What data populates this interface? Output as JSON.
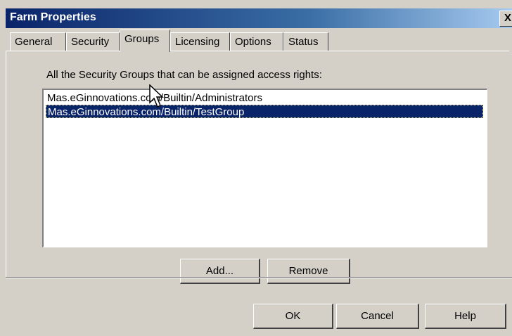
{
  "window": {
    "title": "Farm Properties",
    "close_label": "X"
  },
  "tabs": [
    {
      "label": "General"
    },
    {
      "label": "Security"
    },
    {
      "label": "Groups"
    },
    {
      "label": "Licensing"
    },
    {
      "label": "Options"
    },
    {
      "label": "Status"
    }
  ],
  "active_tab": "Groups",
  "groups_panel": {
    "description": "All the Security Groups that can be assigned access rights:",
    "items": [
      {
        "label": "Mas.eGinnovations.com/Builtin/Administrators",
        "selected": false
      },
      {
        "label": "Mas.eGinnovations.com/Builtin/TestGroup",
        "selected": true
      }
    ],
    "add_label": "Add...",
    "remove_label": "Remove"
  },
  "footer": {
    "ok_label": "OK",
    "cancel_label": "Cancel",
    "help_label": "Help"
  },
  "cursor_icon": "arrow-pointer-icon",
  "colors": {
    "titlebar": "#0a246a",
    "selection": "#0a246a",
    "face": "#d4d0c8"
  }
}
